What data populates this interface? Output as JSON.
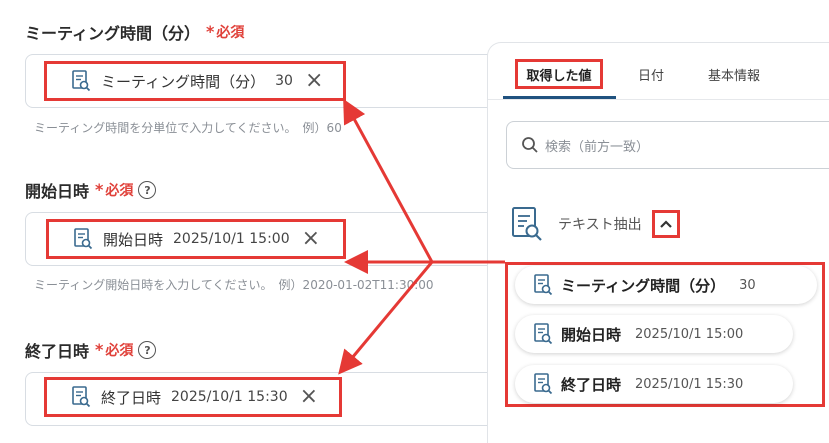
{
  "fields": [
    {
      "label": "ミーティング時間（分）",
      "required": "必須",
      "has_help": false,
      "chip_name": "ミーティング時間（分）",
      "chip_value": "30",
      "hint": "ミーティング時間を分単位で入力してください。　例）60"
    },
    {
      "label": "開始日時",
      "required": "必須",
      "has_help": true,
      "chip_name": "開始日時",
      "chip_value": "2025/10/1 15:00",
      "hint": "ミーティング開始日時を入力してください。　例）2020-01-02T11:30:00"
    },
    {
      "label": "終了日時",
      "required": "必須",
      "has_help": true,
      "chip_name": "終了日時",
      "chip_value": "2025/10/1 15:30",
      "hint": ""
    }
  ],
  "panel": {
    "tabs": [
      "取得した値",
      "日付",
      "基本情報"
    ],
    "active_tab": 0,
    "search_placeholder": "検索（前方一致）",
    "section_title": "テキスト抽出",
    "results": [
      {
        "name": "ミーティング時間（分）",
        "value": "30"
      },
      {
        "name": "開始日時",
        "value": "2025/10/1 15:00"
      },
      {
        "name": "終了日時",
        "value": "2025/10/1 15:30"
      }
    ]
  },
  "icons": {
    "close": "close-icon",
    "doc": "document-search-icon",
    "search": "search-icon",
    "chevron": "chevron-up-icon",
    "help": "help-circle-icon"
  },
  "colors": {
    "highlight": "#e53935",
    "required": "#e0413a",
    "tab_underline": "#20527f"
  }
}
